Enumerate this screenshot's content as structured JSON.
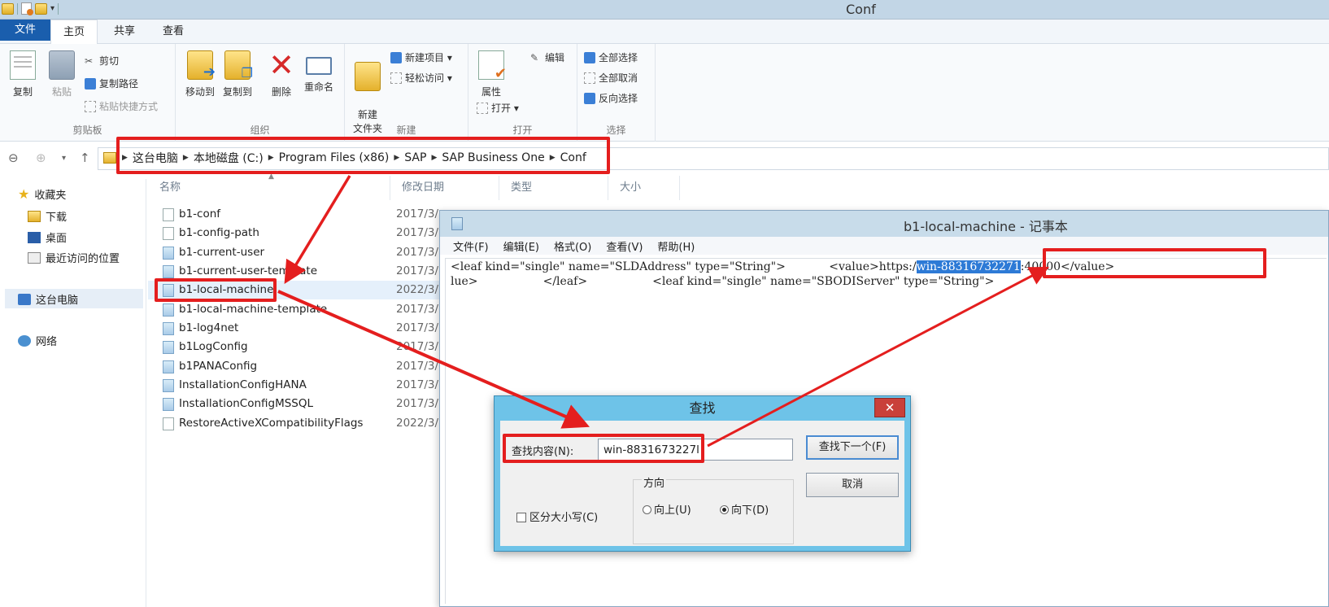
{
  "window": {
    "title": "Conf"
  },
  "ribbon": {
    "tabs": [
      "文件",
      "主页",
      "共享",
      "查看"
    ],
    "groups": {
      "clipboard": {
        "label": "剪贴板",
        "copy": "复制",
        "paste": "粘贴",
        "cut": "剪切",
        "copy_path": "复制路径",
        "paste_shortcut": "粘贴快捷方式"
      },
      "organize": {
        "label": "组织",
        "move_to": "移动到",
        "copy_to": "复制到",
        "delete": "删除",
        "rename": "重命名"
      },
      "new": {
        "label": "新建",
        "new_folder": "新建\n文件夹",
        "new_item": "新建项目 ▾",
        "easy_access": "轻松访问 ▾"
      },
      "open": {
        "label": "打开",
        "properties": "属性",
        "open": "打开 ▾",
        "edit": "编辑"
      },
      "select": {
        "label": "选择",
        "select_all": "全部选择",
        "select_none": "全部取消",
        "invert": "反向选择"
      }
    }
  },
  "address": {
    "crumbs": [
      "这台电脑",
      "本地磁盘 (C:)",
      "Program Files (x86)",
      "SAP",
      "SAP Business One",
      "Conf"
    ]
  },
  "leftnav": {
    "favorites": "收藏夹",
    "downloads": "下载",
    "desktop": "桌面",
    "recent": "最近访问的位置",
    "this_pc": "这台电脑",
    "network": "网络"
  },
  "filelist": {
    "columns": [
      "名称",
      "修改日期",
      "类型",
      "大小"
    ],
    "files": [
      {
        "name": "b1-conf",
        "date": "2017/3/"
      },
      {
        "name": "b1-config-path",
        "date": "2017/3/"
      },
      {
        "name": "b1-current-user",
        "date": "2017/3/"
      },
      {
        "name": "b1-current-user-template",
        "date": "2017/3/"
      },
      {
        "name": "b1-local-machine",
        "date": "2022/3/"
      },
      {
        "name": "b1-local-machine-template",
        "date": "2017/3/"
      },
      {
        "name": "b1-log4net",
        "date": "2017/3/"
      },
      {
        "name": "b1LogConfig",
        "date": "2017/3/"
      },
      {
        "name": "b1PANAConfig",
        "date": "2017/3/"
      },
      {
        "name": "InstallationConfigHANA",
        "date": "2017/3/"
      },
      {
        "name": "InstallationConfigMSSQL",
        "date": "2017/3/"
      },
      {
        "name": "RestoreActiveXCompatibilityFlags",
        "date": "2022/3/"
      }
    ]
  },
  "notepad": {
    "title": "b1-local-machine - 记事本",
    "menu": [
      "文件(F)",
      "编辑(E)",
      "格式(O)",
      "查看(V)",
      "帮助(H)"
    ],
    "line1_a": "<leaf kind=\"single\" name=\"SLDAddress\" type=\"String\">            <value>https:/",
    "line1_hl": "win-88316732271",
    "line1_b": ":40000</value>",
    "line2": "lue>                  </leaf>                  <leaf kind=\"single\" name=\"SBODIServer\" type=\"String\">"
  },
  "find_dialog": {
    "title": "查找",
    "close": "✕",
    "find_label": "查找内容(N):",
    "find_value": "win-8831673227l",
    "find_next": "查找下一个(F)",
    "cancel": "取消",
    "direction": "方向",
    "up": "向上(U)",
    "down": "向下(D)",
    "match_case": "区分大小写(C)"
  }
}
